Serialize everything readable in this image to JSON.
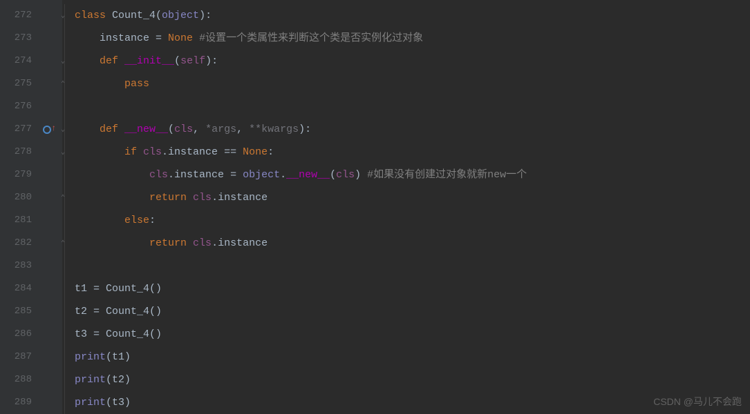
{
  "lines": {
    "272": "272",
    "273": "273",
    "274": "274",
    "275": "275",
    "276": "276",
    "277": "277",
    "278": "278",
    "279": "279",
    "280": "280",
    "281": "281",
    "282": "282",
    "283": "283",
    "284": "284",
    "285": "285",
    "286": "286",
    "287": "287",
    "288": "288",
    "289": "289"
  },
  "code": {
    "l272": {
      "kw_class": "class ",
      "name": "Count_4",
      "p1": "(",
      "obj": "object",
      "p2": "):"
    },
    "l273": {
      "indent": "    ",
      "var": "instance ",
      "eq": "= ",
      "none": "None ",
      "comment": "#设置一个类属性来判断这个类是否实例化过对象"
    },
    "l274": {
      "indent": "    ",
      "kw_def": "def ",
      "fn": "__init__",
      "p1": "(",
      "self": "self",
      "p2": "):"
    },
    "l275": {
      "indent": "        ",
      "kw": "pass"
    },
    "l277": {
      "indent": "    ",
      "kw_def": "def ",
      "fn": "__new__",
      "p1": "(",
      "cls": "cls",
      "c1": ", ",
      "args": "*args",
      "c2": ", ",
      "kwargs": "**kwargs",
      "p2": "):"
    },
    "l278": {
      "indent": "        ",
      "kw_if": "if ",
      "cls": "cls",
      "dot": ".instance ",
      "eq": "== ",
      "none": "None",
      "colon": ":"
    },
    "l279": {
      "indent": "            ",
      "cls": "cls",
      "attr": ".instance ",
      "eq": "= ",
      "obj": "object",
      "dot": ".",
      "new": "__new__",
      "p1": "(",
      "cls2": "cls",
      "p2": ") ",
      "comment": "#如果没有创建过对象就新new一个"
    },
    "l280": {
      "indent": "            ",
      "kw_ret": "return ",
      "cls": "cls",
      "attr": ".instance"
    },
    "l281": {
      "indent": "        ",
      "kw_else": "else",
      "colon": ":"
    },
    "l282": {
      "indent": "            ",
      "kw_ret": "return ",
      "cls": "cls",
      "attr": ".instance"
    },
    "l284": {
      "var": "t1 ",
      "eq": "= ",
      "fn": "Count_4",
      "p": "()"
    },
    "l285": {
      "var": "t2 ",
      "eq": "= ",
      "fn": "Count_4",
      "p": "()"
    },
    "l286": {
      "var": "t3 ",
      "eq": "= ",
      "fn": "Count_4",
      "p": "()"
    },
    "l287": {
      "fn": "print",
      "p1": "(",
      "arg": "t1",
      "p2": ")"
    },
    "l288": {
      "fn": "print",
      "p1": "(",
      "arg": "t2",
      "p2": ")"
    },
    "l289": {
      "fn": "print",
      "p1": "(",
      "arg": "t3",
      "p2": ")"
    }
  },
  "fold": {
    "down": "⌄",
    "up": "⌃",
    "mid": "│"
  },
  "watermark": "CSDN @马儿不会跑"
}
